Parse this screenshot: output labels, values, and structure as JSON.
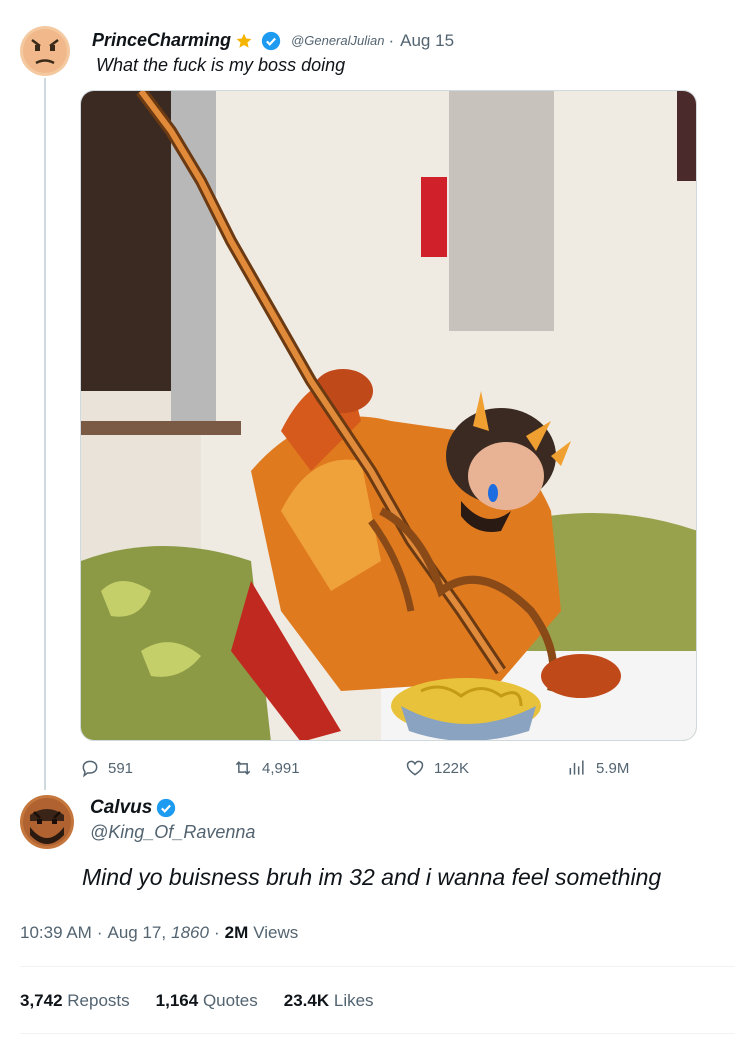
{
  "original": {
    "display_name": "PrinceCharming",
    "handle": "@GeneralJulian",
    "separator": "·",
    "date": "Aug 15",
    "text": "What the fuck is my boss doing",
    "star_icon": "star-icon",
    "verified_icon": "verified-badge-icon"
  },
  "actions": {
    "replies": "591",
    "reposts": "4,991",
    "likes": "122K",
    "views": "5.9M"
  },
  "reply": {
    "display_name": "Calvus",
    "handle": "@King_Of_Ravenna",
    "text": "Mind yo buisness bruh im 32 and i wanna feel something",
    "verified_icon": "verified-badge-icon"
  },
  "meta": {
    "time": "10:39 AM",
    "dot1": "·",
    "date": "Aug 17,",
    "year": "1860",
    "dot2": "·",
    "views_count": "2M",
    "views_label": "Views"
  },
  "stats": {
    "reposts_count": "3,742",
    "reposts_label": "Reposts",
    "quotes_count": "1,164",
    "quotes_label": "Quotes",
    "likes_count": "23.4K",
    "likes_label": "Likes"
  },
  "colors": {
    "verified": "#1d9bf0",
    "star": "#f5b400",
    "secondary_text": "#536471"
  }
}
